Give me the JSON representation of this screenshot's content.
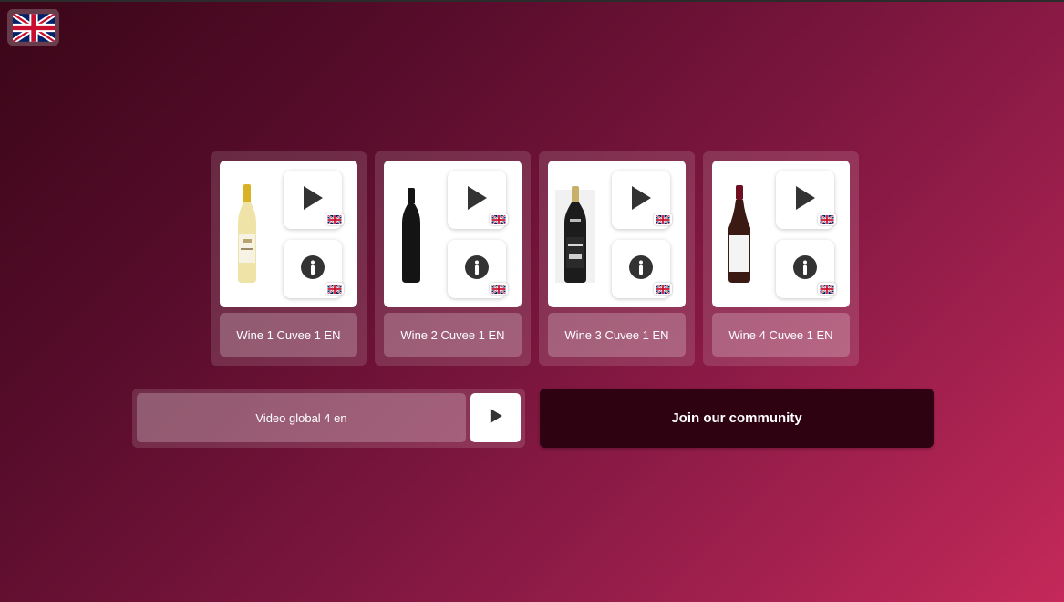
{
  "language": {
    "current": "EN",
    "icon": "uk-flag-icon"
  },
  "wines": [
    {
      "label": "Wine 1 Cuvee 1 EN",
      "bottle": "white-wine",
      "colors": {
        "glass": "#efe3a8",
        "cap": "#d9b325",
        "label": "#f6f2e4"
      }
    },
    {
      "label": "Wine 2 Cuvee 1 EN",
      "bottle": "dark-bottle",
      "colors": {
        "glass": "#141414",
        "cap": "#141414",
        "label": "#141414"
      }
    },
    {
      "label": "Wine 3 Cuvee 1 EN",
      "bottle": "dark-labeled",
      "colors": {
        "glass": "#1c1c1c",
        "cap": "#c9b06a",
        "label": "#2a2a2a"
      }
    },
    {
      "label": "Wine 4 Cuvee 1 EN",
      "bottle": "burgundy-bottle",
      "colors": {
        "glass": "#3b1a14",
        "cap": "#6e1020",
        "label": "#f4f4f4"
      }
    }
  ],
  "video": {
    "label": "Video global 4 en",
    "icon": "play-icon"
  },
  "community": {
    "label": "Join our community"
  },
  "colors": {
    "bg_dark": "#3a0618",
    "bg_light": "#c4295a",
    "button_dark": "#2e0211"
  }
}
